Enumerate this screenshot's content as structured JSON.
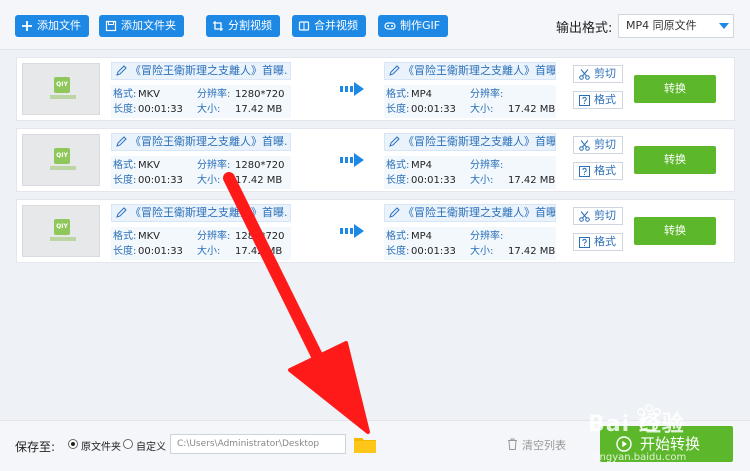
{
  "toolbar": {
    "add_file": "添加文件",
    "add_folder": "添加文件夹",
    "split_video": "分割视频",
    "merge_video": "合并视频",
    "make_gif": "制作GIF",
    "output_label": "输出格式:",
    "output_value": "MP4  同原文件"
  },
  "labels": {
    "format": "格式:",
    "resolution": "分辨率:",
    "duration": "长度:",
    "size": "大小:",
    "cut": "剪切",
    "format_btn": "格式",
    "convert": "转换"
  },
  "rows": [
    {
      "src": {
        "title": "《冒险王衛斯理之支離人》首曝.",
        "format": "MKV",
        "resolution": "1280*720",
        "duration": "00:01:33",
        "size": "17.42 MB"
      },
      "dst": {
        "title": "《冒险王衛斯理之支離人》首曝.",
        "format": "MP4",
        "resolution": "",
        "duration": "00:01:33",
        "size": "17.42 MB"
      }
    },
    {
      "src": {
        "title": "《冒险王衛斯理之支離人》首曝.",
        "format": "MKV",
        "resolution": "1280*720",
        "duration": "00:01:33",
        "size": "17.42 MB"
      },
      "dst": {
        "title": "《冒险王衛斯理之支離人》首曝.",
        "format": "MP4",
        "resolution": "",
        "duration": "00:01:33",
        "size": "17.42 MB"
      }
    },
    {
      "src": {
        "title": "《冒险王衛斯理之支離人》首曝.",
        "format": "MKV",
        "resolution": "1280*720",
        "duration": "00:01:33",
        "size": "17.42 MB"
      },
      "dst": {
        "title": "《冒险王衛斯理之支離人》首曝.",
        "format": "MP4",
        "resolution": "",
        "duration": "00:01:33",
        "size": "17.42 MB"
      }
    }
  ],
  "bottom": {
    "save_to": "保存至:",
    "opt_original": "原文件夹",
    "opt_custom": "自定义",
    "path": "C:\\Users\\Administrator\\Desktop",
    "clear_list": "清空列表",
    "start": "开始转换"
  },
  "watermark": {
    "brand": "Bai  经验",
    "url": "jingyan.baidu.com"
  },
  "colors": {
    "accent": "#1e88e5",
    "green": "#5cb82a",
    "annotation": "#ff1a1a"
  }
}
